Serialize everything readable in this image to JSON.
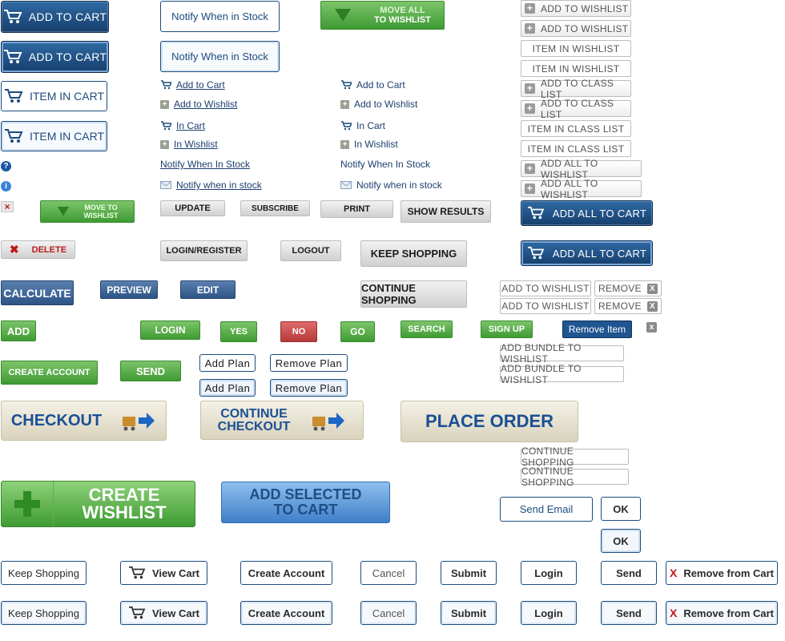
{
  "cart_buttons": {
    "add_to_cart": "ADD TO CART",
    "item_in_cart": "ITEM IN CART"
  },
  "notify": {
    "label": "Notify When in Stock"
  },
  "move_all": {
    "line1": "MOVE ALL",
    "line2": "TO WISHLIST"
  },
  "move_to": {
    "line1": "MOVE TO",
    "line2": "WISHLIST"
  },
  "links_underlined": {
    "add_to_cart": "Add to Cart",
    "add_to_wishlist": "Add to Wishlist",
    "in_cart": "In Cart",
    "in_wishlist": "In Wishlist",
    "notify_when_in_stock": "Notify When In Stock",
    "notify_when_in_stock_lower": "Notify when in stock"
  },
  "links_plain": {
    "add_to_cart": "Add to Cart",
    "add_to_wishlist": "Add to Wishlist",
    "in_cart": "In Cart",
    "in_wishlist": "In Wishlist",
    "notify_when_in_stock": "Notify When In Stock",
    "notify_when_in_stock_lower": "Notify when in stock"
  },
  "icons": {
    "question": "?",
    "info": "i",
    "x": "×"
  },
  "gray_buttons": {
    "update": "UPDATE",
    "subscribe": "SUBSCRIBE",
    "print": "PRINT",
    "show_results": "SHOW RESULTS",
    "delete": "DELETE",
    "login_register": "LOGIN/REGISTER",
    "logout": "LOGOUT",
    "keep_shopping": "KEEP SHOPPING",
    "continue_shopping": "CONTINUE SHOPPING"
  },
  "right_column": {
    "add_to_wishlist": "ADD TO WISHLIST",
    "item_in_wishlist": "ITEM IN WISHLIST",
    "add_to_class_list": "ADD TO CLASS LIST",
    "item_in_class_list": "ITEM IN CLASS LIST",
    "add_all_to_wishlist": "ADD ALL TO WISHLIST",
    "add_all_to_cart": "ADD ALL TO CART",
    "remove": "REMOVE",
    "remove_item": "Remove Item",
    "add_bundle_to_wishlist": "ADD BUNDLE TO WISHLIST",
    "continue_shopping": "CONTINUE SHOPPING",
    "send_email": "Send Email",
    "ok": "OK"
  },
  "navy_buttons": {
    "calculate": "CALCULATE",
    "preview": "PREVIEW",
    "edit": "EDIT"
  },
  "green_buttons": {
    "add": "ADD",
    "login": "LOGIN",
    "yes": "YES",
    "go": "GO",
    "search": "SEARCH",
    "sign_up": "SIGN UP",
    "create_account": "CREATE ACCOUNT",
    "send": "SEND"
  },
  "red_buttons": {
    "no": "NO"
  },
  "plans": {
    "add_plan": "Add Plan",
    "remove_plan": "Remove Plan"
  },
  "big_buttons": {
    "checkout": "CHECKOUT",
    "continue_checkout_1": "CONTINUE",
    "continue_checkout_2": "CHECKOUT",
    "place_order": "PLACE ORDER",
    "create_wishlist_1": "CREATE",
    "create_wishlist_2": "WISHLIST",
    "add_selected_1": "ADD SELECTED",
    "add_selected_2": "TO CART"
  },
  "bottom_buttons": {
    "keep_shopping": "Keep Shopping",
    "view_cart": "View Cart",
    "create_account": "Create Account",
    "cancel": "Cancel",
    "submit": "Submit",
    "login": "Login",
    "send": "Send",
    "remove_from_cart": "Remove from Cart"
  },
  "colors": {
    "brand_navy": "#163f6e",
    "green": "#3f9b33",
    "red": "#b53a3a",
    "tan": "#d9d3bd",
    "text_blue": "#1b4f95"
  }
}
